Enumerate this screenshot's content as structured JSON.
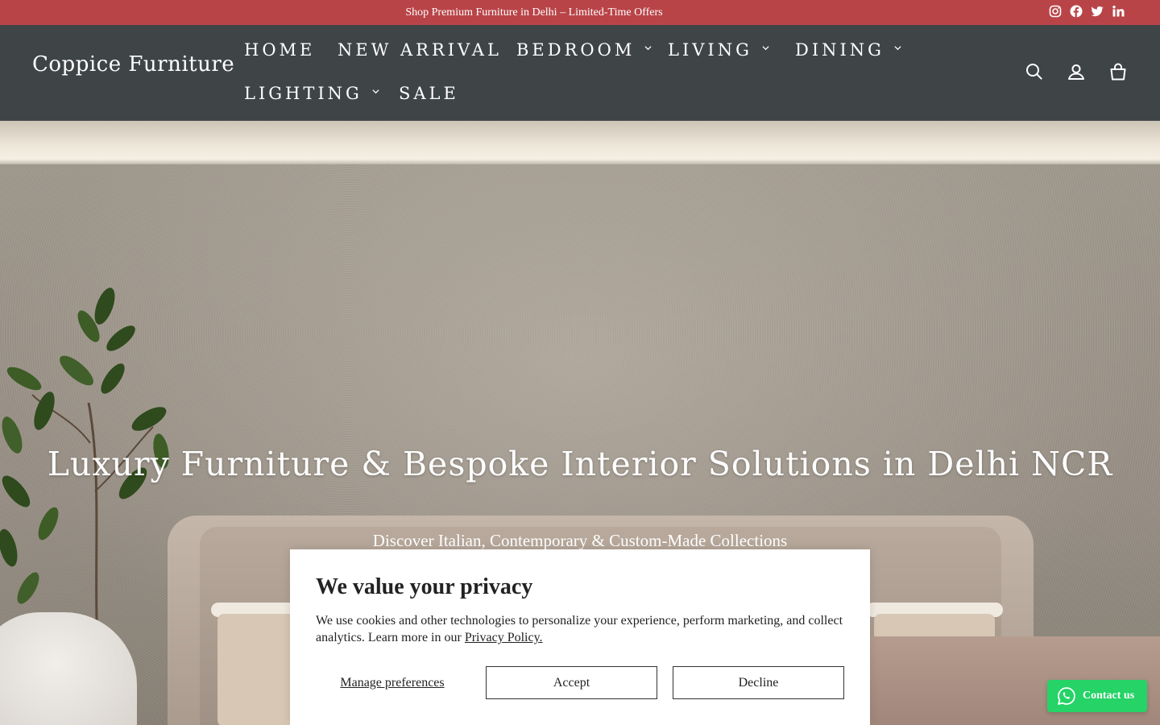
{
  "announcement": {
    "text": "Shop Premium Furniture in Delhi – Limited-Time Offers",
    "social_icons": [
      "instagram-icon",
      "facebook-icon",
      "twitter-icon",
      "linkedin-icon"
    ]
  },
  "header": {
    "logo": "Coppice Furniture",
    "nav": [
      {
        "label": "HOME",
        "dropdown": false
      },
      {
        "label": "NEW ARRIVAL",
        "dropdown": false
      },
      {
        "label": "BEDROOM",
        "dropdown": true
      },
      {
        "label": "LIVING",
        "dropdown": true
      },
      {
        "label": "DINING",
        "dropdown": true
      },
      {
        "label": "LIGHTING",
        "dropdown": true
      },
      {
        "label": "SALE",
        "dropdown": false
      }
    ],
    "icons": [
      "search-icon",
      "account-icon",
      "cart-icon"
    ]
  },
  "hero": {
    "title": "Luxury Furniture & Bespoke Interior Solutions in Delhi NCR",
    "subtitle": "Discover Italian, Contemporary & Custom-Made Collections"
  },
  "cookie": {
    "title": "We value your privacy",
    "body": "We use cookies and other technologies to personalize your experience, perform marketing, and collect analytics. Learn more in our ",
    "link": "Privacy Policy.",
    "manage": "Manage preferences",
    "accept": "Accept",
    "decline": "Decline"
  },
  "contact": {
    "label": "Contact us"
  },
  "colors": {
    "announcement_bg": "#b94448",
    "header_bg": "#3f4547",
    "whatsapp": "#25d366"
  }
}
